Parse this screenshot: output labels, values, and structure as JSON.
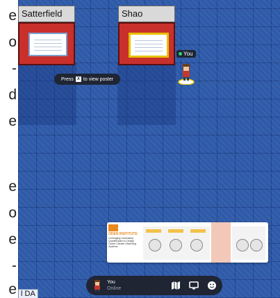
{
  "left_fragments": [
    "e",
    "o",
    "-",
    "d",
    "e",
    "e",
    "o",
    "e",
    "-",
    "e"
  ],
  "booths": [
    {
      "name": "Satterfield",
      "active": false
    },
    {
      "name": "Shao",
      "active": true
    }
  ],
  "hint": {
    "prefix": "Press",
    "key": "X",
    "suffix": "to view poster"
  },
  "player_tag": "You",
  "poster_preview": {
    "institute": "ODEN INSTITUTE",
    "title": "Leveraging Uncertainty Quantification to Design Ocean Climate Observing Systems"
  },
  "dock": {
    "name": "You",
    "status": "Online"
  },
  "corner_label": "l DA",
  "colors": {
    "map": "#2e5aa8",
    "board": "#c9302c",
    "dock": "#1f2533",
    "online": "#31d26e"
  },
  "icons": [
    "map-icon",
    "screen-share-icon",
    "emoji-icon"
  ]
}
